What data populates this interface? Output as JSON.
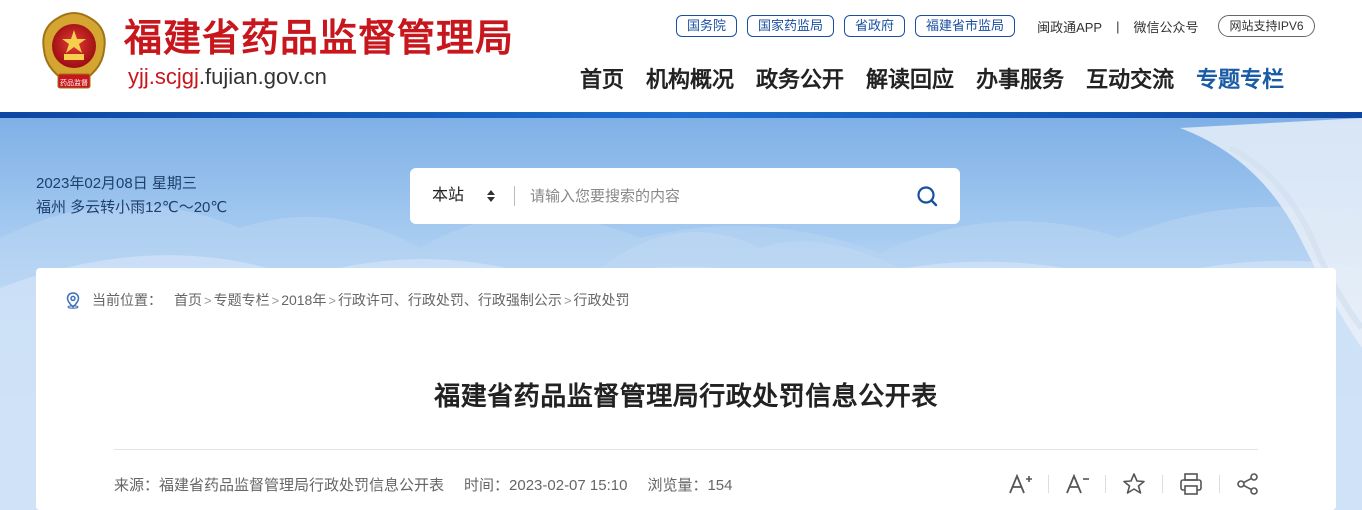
{
  "header": {
    "site_title": "福建省药品监督管理局",
    "domain_highlight": "yjj.scjgj",
    "domain_rest": ".fujian.gov.cn",
    "emblem_caption": "药品监督",
    "top_links": [
      "国务院",
      "国家药监局",
      "省政府",
      "福建省市监局"
    ],
    "app_link": "闽政通APP",
    "separator": "|",
    "wechat_link": "微信公众号",
    "ipv6_badge": "网站支持IPV6",
    "nav": [
      "首页",
      "机构概况",
      "政务公开",
      "解读回应",
      "办事服务",
      "互动交流",
      "专题专栏"
    ],
    "active_nav": "专题专栏",
    "accent_color": "#c8161d",
    "brand_blue": "#1a4fa0"
  },
  "banner": {
    "date": "2023年02月08日 星期三",
    "weather": "福州 多云转小雨12℃～20℃"
  },
  "search": {
    "scope": "本站",
    "placeholder": "请输入您要搜索的内容",
    "scope_icon": "sort-arrows-icon",
    "submit_icon": "search-icon"
  },
  "breadcrumb": {
    "lead": "当前位置：",
    "items": [
      "首页",
      "专题专栏",
      "2018年",
      "行政许可、行政处罚、行政强制公示",
      "行政处罚"
    ],
    "sep": ">"
  },
  "article": {
    "title": "福建省药品监督管理局行政处罚信息公开表",
    "source": "来源：福建省药品监督管理局行政处罚信息公开表",
    "time": "时间：2023-02-07 15:10",
    "views": "浏览量：154"
  },
  "tools": [
    "font-increase-icon",
    "font-decrease-icon",
    "star-icon",
    "print-icon",
    "share-icon"
  ]
}
